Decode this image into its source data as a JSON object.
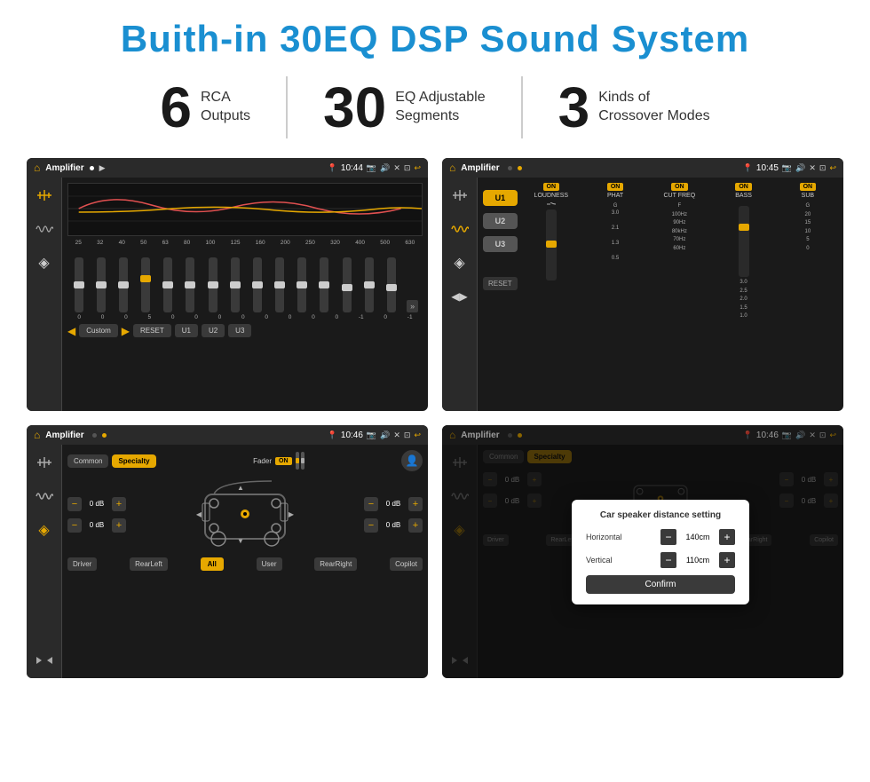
{
  "header": {
    "title": "Buith-in 30EQ DSP Sound System"
  },
  "features": [
    {
      "number": "6",
      "line1": "RCA",
      "line2": "Outputs"
    },
    {
      "number": "30",
      "line1": "EQ Adjustable",
      "line2": "Segments"
    },
    {
      "number": "3",
      "line1": "Kinds of",
      "line2": "Crossover Modes"
    }
  ],
  "screens": {
    "eq": {
      "title": "Amplifier",
      "time": "10:44",
      "eq_labels": [
        "25",
        "32",
        "40",
        "50",
        "63",
        "80",
        "100",
        "125",
        "160",
        "200",
        "250",
        "320",
        "400",
        "500",
        "630"
      ],
      "eq_values": [
        "0",
        "0",
        "0",
        "5",
        "0",
        "0",
        "0",
        "0",
        "0",
        "0",
        "0",
        "0",
        "-1",
        "0",
        "-1"
      ],
      "buttons": [
        "Custom",
        "RESET",
        "U1",
        "U2",
        "U3"
      ]
    },
    "crossover": {
      "title": "Amplifier",
      "time": "10:45",
      "u_buttons": [
        "U1",
        "U2",
        "U3"
      ],
      "controls": [
        "LOUDNESS",
        "PHAT",
        "CUT FREQ",
        "BASS",
        "SUB"
      ],
      "reset_label": "RESET"
    },
    "speaker": {
      "title": "Amplifier",
      "time": "10:46",
      "tabs": [
        "Common",
        "Specialty"
      ],
      "fader_label": "Fader",
      "fader_on": "ON",
      "vol_values": [
        "0 dB",
        "0 dB",
        "0 dB",
        "0 dB"
      ],
      "bottom_buttons": [
        "Driver",
        "RearLeft",
        "All",
        "User",
        "RearRight",
        "Copilot"
      ]
    },
    "distance": {
      "title": "Amplifier",
      "time": "10:46",
      "dialog_title": "Car speaker distance setting",
      "horizontal_label": "Horizontal",
      "horizontal_value": "140cm",
      "vertical_label": "Vertical",
      "vertical_value": "110cm",
      "confirm_label": "Confirm",
      "tabs": [
        "Common",
        "Specialty"
      ],
      "vol_label_right1": "0 dB",
      "vol_label_right2": "0 dB",
      "bottom_buttons": [
        "Driver",
        "RearLef...",
        "All",
        "User",
        "RearRight",
        "Copilot"
      ]
    }
  },
  "icons": {
    "home": "⌂",
    "play": "▶",
    "pause": "⏸",
    "location": "📍",
    "camera": "📷",
    "volume": "🔊",
    "x": "✕",
    "window": "⊡",
    "back": "↩",
    "sliders": "⚙",
    "eq_icon": "≈",
    "speaker_icon": "◈",
    "left_arrow": "◀",
    "right_arrow": "▶",
    "chevron_down": "▾",
    "chevron_up": "▴"
  }
}
